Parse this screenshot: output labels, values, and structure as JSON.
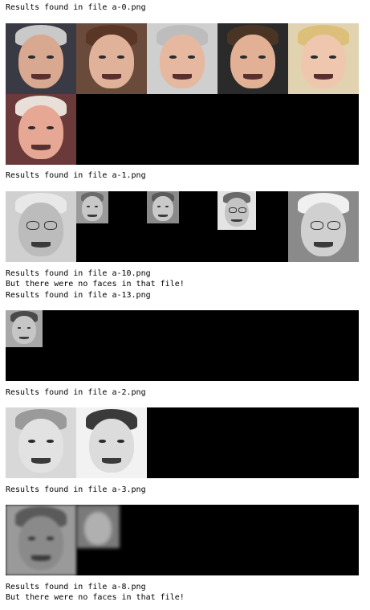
{
  "output": {
    "lines": [
      "Results found in file a-0.png",
      "Results found in file a-1.png",
      "Results found in file a-10.png",
      "But there were no faces in that file!",
      "Results found in file a-13.png",
      "Results found in file a-2.png",
      "Results found in file a-3.png",
      "Results found in file a-8.png",
      "But there were no faces in that file!"
    ]
  },
  "colors": {
    "background": "#ffffff",
    "panel": "#000000",
    "text": "#000000"
  }
}
